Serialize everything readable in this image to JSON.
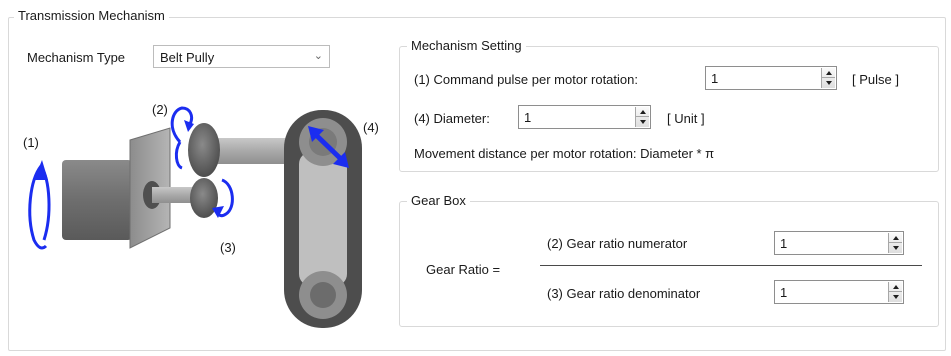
{
  "transmission": {
    "title": "Transmission Mechanism",
    "mechanism_type_label": "Mechanism Type",
    "mechanism_type_value": "Belt Pully",
    "diagram_labels": [
      "(1)",
      "(2)",
      "(3)",
      "(4)"
    ]
  },
  "mechanism_setting": {
    "title": "Mechanism Setting",
    "command_pulse_label": "(1) Command pulse per motor rotation:",
    "command_pulse_value": "1",
    "command_pulse_unit": "[ Pulse ]",
    "diameter_label": "(4) Diameter:",
    "diameter_value": "1",
    "diameter_unit": "[ Unit ]",
    "formula_text": "Movement distance per motor rotation: Diameter * π"
  },
  "gear_box": {
    "title": "Gear Box",
    "gear_ratio_label": "Gear Ratio =",
    "numerator_label": "(2) Gear ratio numerator",
    "numerator_value": "1",
    "denominator_label": "(3) Gear ratio denominator",
    "denominator_value": "1"
  },
  "icons": {
    "combo_arrow": "chevron-down-icon",
    "spin_up": "triangle-up-icon",
    "spin_down": "triangle-down-icon"
  },
  "colors": {
    "rotation_arrow": "#1b2df0",
    "frame_border": "#d9d9d9",
    "belt": "#505050"
  }
}
